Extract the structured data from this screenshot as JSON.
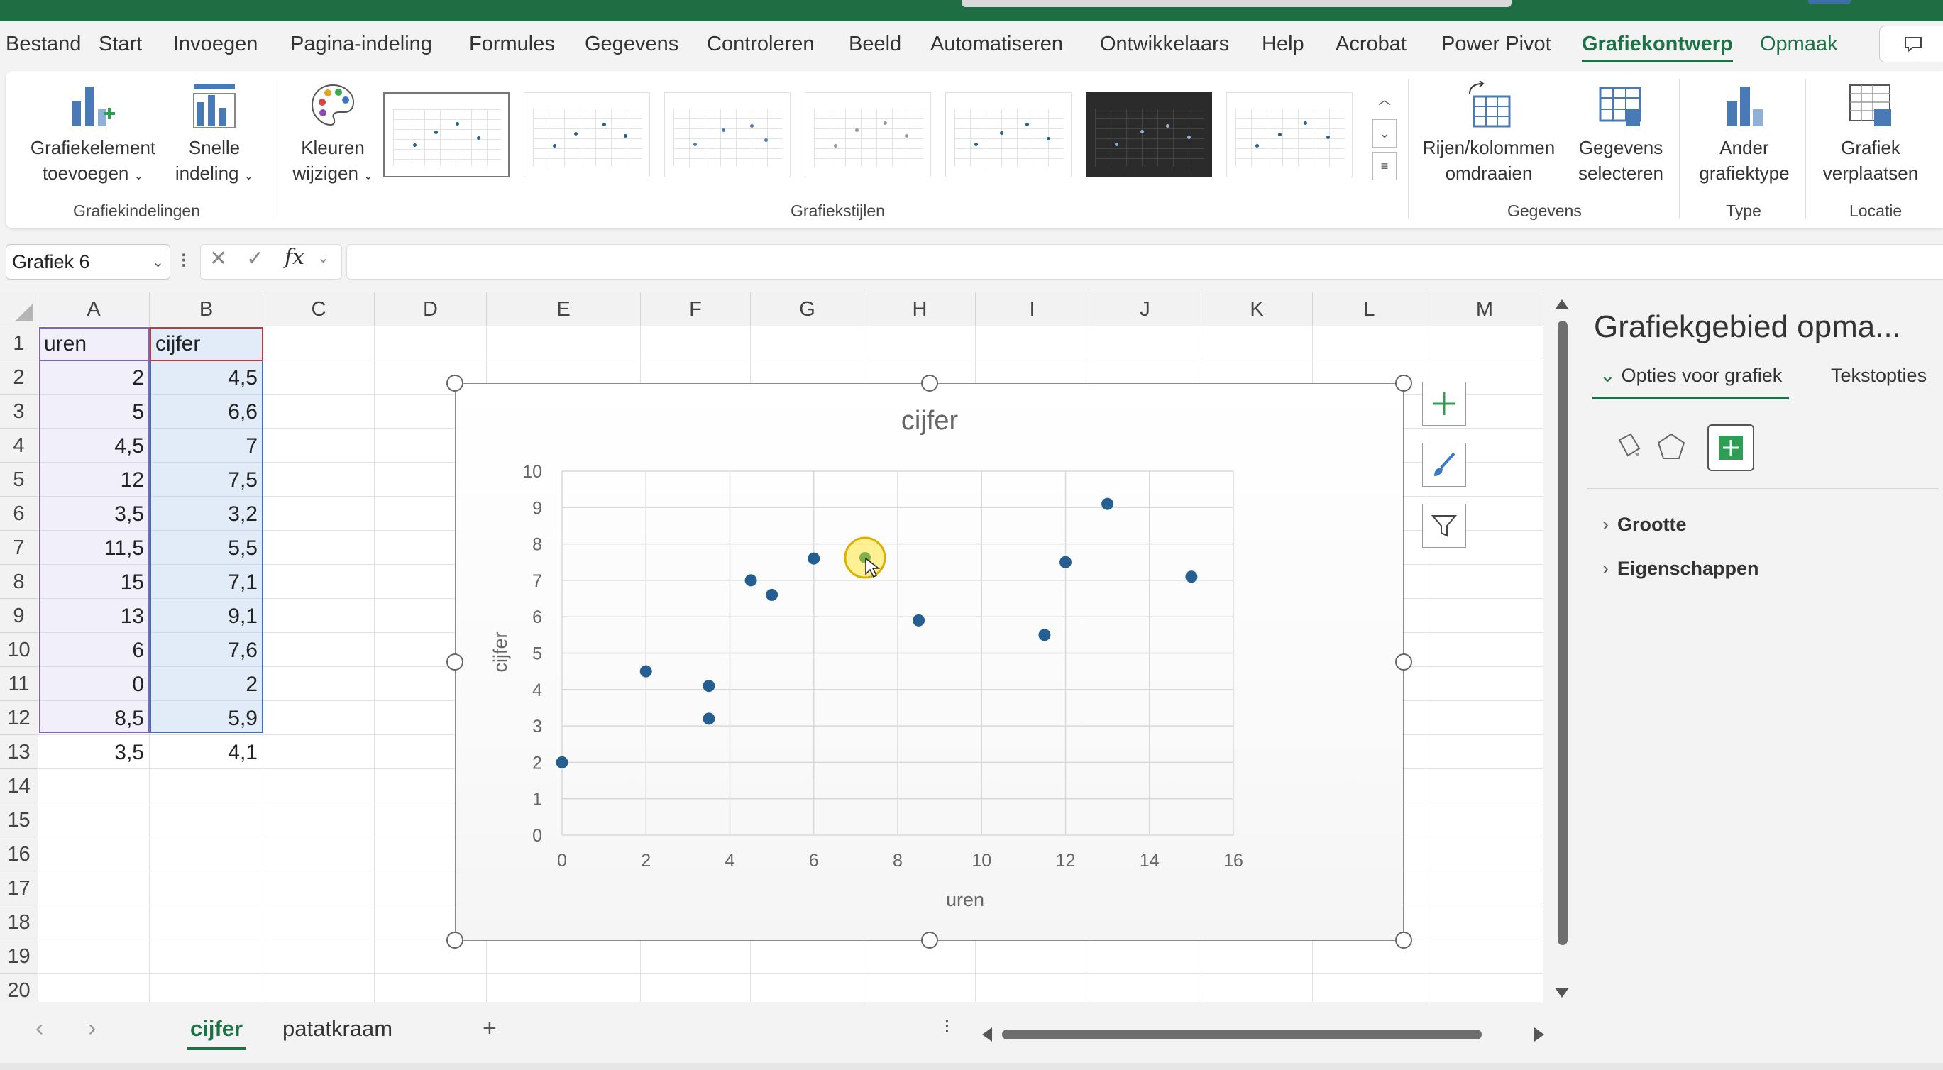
{
  "menu": {
    "tabs": [
      "Bestand",
      "Start",
      "Invoegen",
      "Pagina-indeling",
      "Formules",
      "Gegevens",
      "Controleren",
      "Beeld",
      "Automatiseren",
      "Ontwikkelaars",
      "Help",
      "Acrobat",
      "Power Pivot",
      "Grafiekontwerp",
      "Opmaak"
    ],
    "active": "Grafiekontwerp"
  },
  "ribbon": {
    "add_element": [
      "Grafiekelement",
      "toevoegen"
    ],
    "quick_layout": [
      "Snelle",
      "indeling"
    ],
    "change_colors": [
      "Kleuren",
      "wijzigen"
    ],
    "group_layouts": "Grafiekindelingen",
    "group_styles": "Grafiekstijlen",
    "switch_rowcol": [
      "Rijen/kolommen",
      "omdraaien"
    ],
    "select_data": [
      "Gegevens",
      "selecteren"
    ],
    "group_data": "Gegevens",
    "change_type": [
      "Ander",
      "grafiektype"
    ],
    "group_type": "Type",
    "move_chart": [
      "Grafiek",
      "verplaatsen"
    ],
    "group_location": "Locatie"
  },
  "formula_bar": {
    "name_box": "Grafiek 6",
    "formula": ""
  },
  "sheet": {
    "columns": [
      "A",
      "B",
      "C",
      "D",
      "E",
      "F",
      "G",
      "H",
      "I",
      "J",
      "K",
      "L",
      "M"
    ],
    "rows": [
      "1",
      "2",
      "3",
      "4",
      "5",
      "6",
      "7",
      "8",
      "9",
      "10",
      "11",
      "12",
      "13",
      "14",
      "15",
      "16",
      "17",
      "18",
      "19",
      "20"
    ],
    "header": [
      "uren",
      "cijfer"
    ],
    "data": [
      [
        "2",
        "4,5"
      ],
      [
        "5",
        "6,6"
      ],
      [
        "4,5",
        "7"
      ],
      [
        "12",
        "7,5"
      ],
      [
        "3,5",
        "3,2"
      ],
      [
        "11,5",
        "5,5"
      ],
      [
        "15",
        "7,1"
      ],
      [
        "13",
        "9,1"
      ],
      [
        "6",
        "7,6"
      ],
      [
        "0",
        "2"
      ],
      [
        "8,5",
        "5,9"
      ],
      [
        "3,5",
        "4,1"
      ]
    ]
  },
  "chart_data": {
    "type": "scatter",
    "title": "cijfer",
    "xlabel": "uren",
    "ylabel": "cijfer",
    "xlim": [
      0,
      16
    ],
    "ylim": [
      0,
      10
    ],
    "x_ticks": [
      "0",
      "2",
      "4",
      "6",
      "8",
      "10",
      "12",
      "14",
      "16"
    ],
    "y_ticks": [
      "0",
      "1",
      "2",
      "3",
      "4",
      "5",
      "6",
      "7",
      "8",
      "9",
      "10"
    ],
    "grid": true,
    "legend": "none",
    "marker_color": "#255e91",
    "series": [
      {
        "x": [
          2,
          5,
          4.5,
          12,
          3.5,
          11.5,
          15,
          13,
          6,
          0,
          8.5,
          3.5
        ],
        "y": [
          4.5,
          6.6,
          7,
          7.5,
          3.2,
          5.5,
          7.1,
          9.1,
          7.6,
          2,
          5.9,
          4.1
        ]
      }
    ]
  },
  "pane": {
    "title": "Grafiekgebied opma...",
    "tab_chart": "Opties voor grafiek",
    "tab_text": "Tekstopties",
    "section_size": "Grootte",
    "section_props": "Eigenschappen"
  },
  "sheets": {
    "tabs": [
      "cijfer",
      "patatkraam"
    ],
    "active": "cijfer"
  },
  "colors": {
    "accent": "#1e7145",
    "title_bar": "#1f6e43",
    "marker": "#255e91"
  }
}
